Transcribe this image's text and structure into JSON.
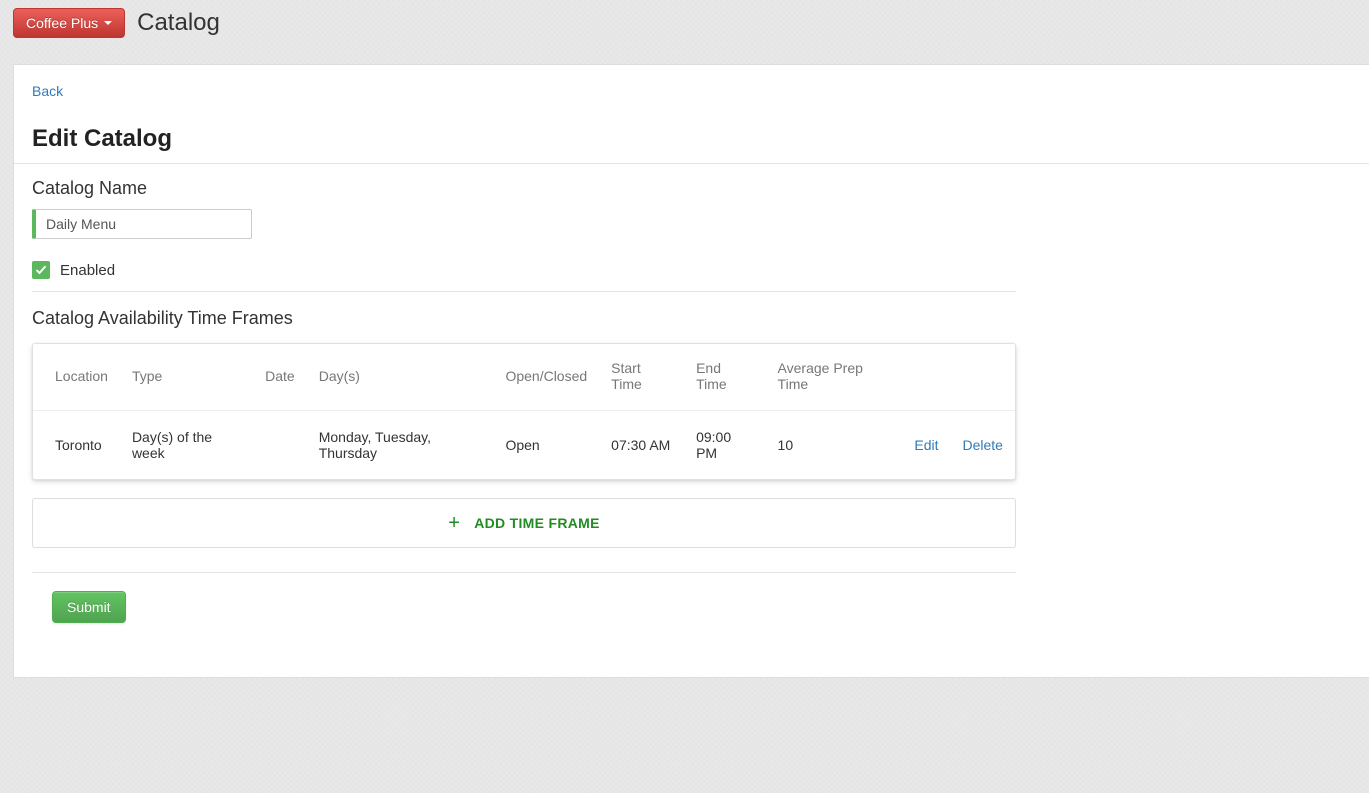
{
  "navbar": {
    "brand_label": "Coffee Plus",
    "page_title": "Catalog"
  },
  "panel": {
    "back_label": "Back",
    "heading": "Edit Catalog"
  },
  "form": {
    "name_label": "Catalog Name",
    "name_value": "Daily Menu",
    "enabled_label": "Enabled",
    "enabled_checked": true
  },
  "timeframes": {
    "section_heading": "Catalog Availability Time Frames",
    "columns": {
      "location": "Location",
      "type": "Type",
      "date": "Date",
      "days": "Day(s)",
      "open_closed": "Open/Closed",
      "start_time": "Start Time",
      "end_time": "End Time",
      "avg_prep": "Average Prep Time"
    },
    "rows": [
      {
        "location": "Toronto",
        "type": "Day(s) of the week",
        "date": "",
        "days": "Monday, Tuesday, Thursday",
        "open_closed": "Open",
        "start_time": "07:30 AM",
        "end_time": "09:00 PM",
        "avg_prep": "10"
      }
    ],
    "actions": {
      "edit": "Edit",
      "delete": "Delete"
    },
    "add_label": "ADD TIME FRAME"
  },
  "submit_label": "Submit"
}
